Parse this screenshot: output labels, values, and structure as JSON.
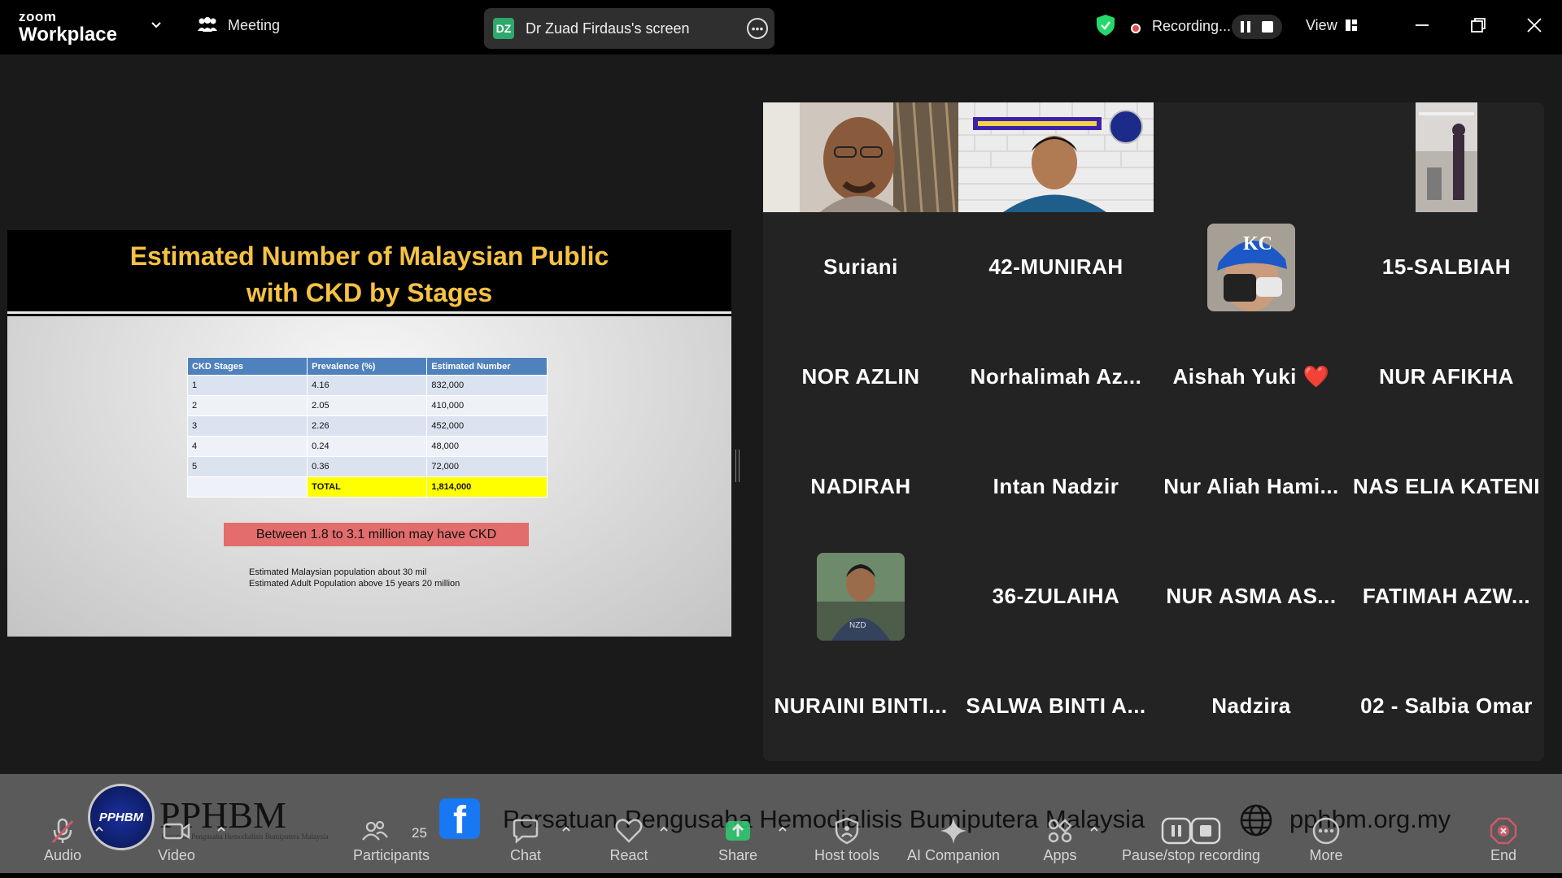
{
  "topbar": {
    "brand_small": "zoom",
    "brand_large": "Workplace",
    "meeting_label": "Meeting",
    "presenter_initials": "DZ",
    "screen_label": "Dr Zuad Firdaus's screen",
    "recording_label": "Recording...",
    "view_label": "View"
  },
  "slide": {
    "title_line1": "Estimated Number of Malaysian Public",
    "title_line2": "with CKD by Stages",
    "table": {
      "headers": [
        "CKD Stages",
        "Prevalence (%)",
        "Estimated Number"
      ],
      "rows": [
        [
          "1",
          "4.16",
          "832,000"
        ],
        [
          "2",
          "2.05",
          "410,000"
        ],
        [
          "3",
          "2.26",
          "452,000"
        ],
        [
          "4",
          "0.24",
          "48,000"
        ],
        [
          "5",
          "0.36",
          "72,000"
        ]
      ],
      "total_label": "TOTAL",
      "total_value": "1,814,000"
    },
    "callout": "Between 1.8 to 3.1 million may have CKD",
    "note_line1": "Estimated Malaysian population about 30 mil",
    "note_line2": "Estimated Adult Population above 15 years 20 million"
  },
  "gallery": {
    "names": [
      "Suriani",
      "42-MUNIRAH",
      "15-SALBIAH",
      "NOR AZLIN",
      "Norhalimah  Az...",
      "Aishah Yuki ❤️",
      "NUR AFIKHA",
      "NADIRAH",
      "Intan Nadzir",
      "Nur  Aliah  Hami...",
      "NAS ELIA KATENI",
      "36-ZULAIHA",
      "NUR ASMA  AS...",
      "FATIMAH  AZW...",
      "NURAINI  BINTI...",
      "SALWA  BINTI  A...",
      "Nadzira",
      "02 - Salbia Omar"
    ]
  },
  "banner": {
    "logo_text": "PPHBM",
    "org_short": "PPHBM",
    "org_tagline": "Persatuan Pengusaha Hemodialisis Bumiputera Malaysia",
    "fb_letter": "f",
    "org_full": "Persatuan Pengusaha Hemodialisis Bumiputera Malaysia",
    "website": "pphbm.org.my"
  },
  "toolbar": {
    "audio": "Audio",
    "video": "Video",
    "participants": "Participants",
    "participant_count": "25",
    "chat": "Chat",
    "react": "React",
    "share": "Share",
    "host_tools": "Host tools",
    "ai_companion": "AI Companion",
    "apps": "Apps",
    "pause_stop": "Pause/stop recording",
    "more": "More",
    "end": "End"
  },
  "colors": {
    "accent_green": "#23d96a",
    "recording_red": "#e94a4a",
    "slide_title": "#f5c242",
    "table_header": "#4f81bd",
    "total_highlight": "#ffff00",
    "callout": "#e36c6c",
    "share_green": "#2ecc71",
    "end_red": "#e05a6a"
  }
}
